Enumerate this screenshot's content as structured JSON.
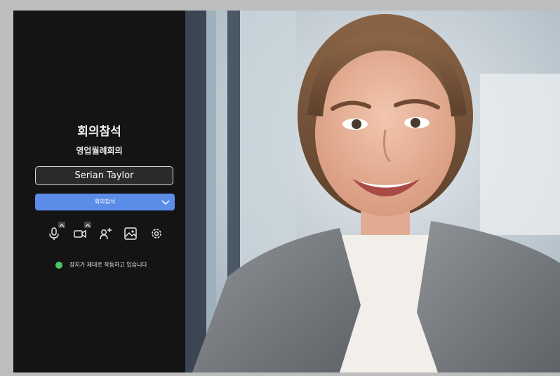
{
  "join_panel": {
    "title": "회의참석",
    "meeting_name": "영업월례회의",
    "name_input_value": "Serian Taylor",
    "join_button_label": "회의참석",
    "status_text": "장치가 제대로 작동하고 있습니다",
    "status_color": "#4ec46a",
    "accent_color": "#5b8de8"
  },
  "toolbar": {
    "icons": [
      "microphone-icon",
      "camera-icon",
      "add-person-icon",
      "background-image-icon",
      "settings-icon"
    ]
  },
  "video": {
    "subject": "participant-camera-preview"
  }
}
